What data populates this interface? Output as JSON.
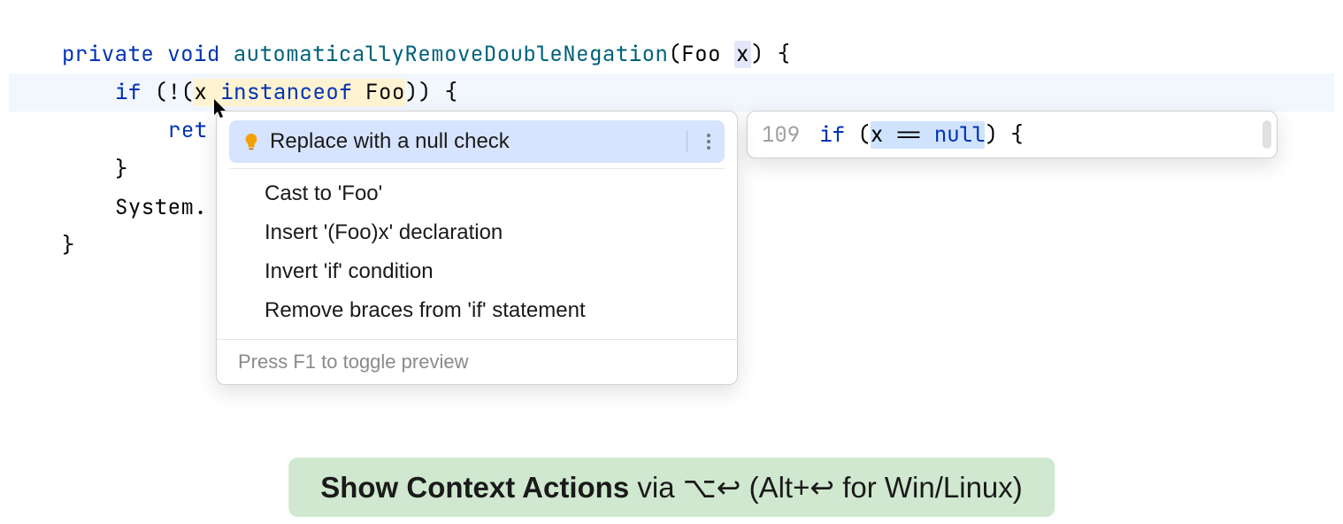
{
  "code": {
    "private": "private",
    "void": "void",
    "method_name": "automaticallyRemoveDoubleNegation",
    "param_type": "Foo",
    "param_name": "x",
    "brace_open": "{",
    "if": "if",
    "not_open": "(!(",
    "var_x": "x",
    "instanceof": "instanceof",
    "foo_type": "Foo",
    "close_cond": "))",
    "brace_open2": "{",
    "return_prefix": "ret",
    "brace_close": "}",
    "system_prefix": "System.",
    "final_brace": "}"
  },
  "popup": {
    "items": {
      "replace_null": "Replace with a null check",
      "cast_foo": "Cast to 'Foo'",
      "insert_decl": "Insert '(Foo)x' declaration",
      "invert_if": "Invert 'if' condition",
      "remove_braces": "Remove braces from 'if' statement"
    },
    "footer": "Press F1 to toggle preview"
  },
  "preview": {
    "line_no": "109",
    "if": "if",
    "open": " (",
    "x": "x",
    "eq": " == ",
    "null": "null",
    "close": ")",
    "brace": " {"
  },
  "banner": {
    "strong": "Show Context Actions",
    "via": " via ",
    "mac_keys": "⌥↩",
    "paren_open": " (",
    "alt": "Alt+",
    "enter": "↩",
    "rest": " for Win/Linux)"
  },
  "icons": {
    "bulb": "lightbulb-icon",
    "kebab": "more-vert-icon",
    "cursor": "mouse-cursor"
  }
}
